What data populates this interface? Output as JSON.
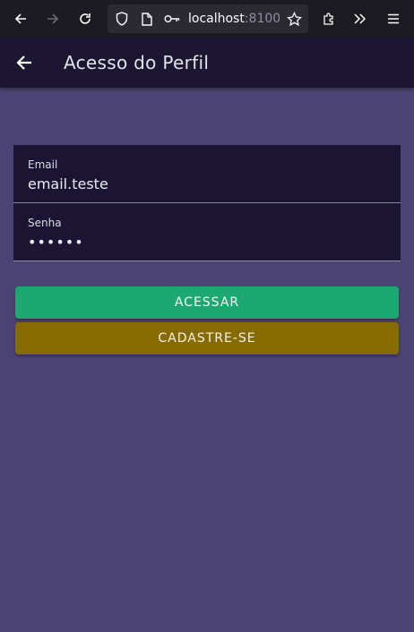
{
  "browser": {
    "url_host": "localhost",
    "url_rest": ":8100/"
  },
  "header": {
    "title": "Acesso do Perfil"
  },
  "form": {
    "email_label": "Email",
    "email_value": "email.teste",
    "senha_label": "Senha",
    "senha_value": "••••••"
  },
  "buttons": {
    "acessar": "ACESSAR",
    "cadastro": "CADASTRE-SE"
  },
  "colors": {
    "background": "#4b4373",
    "header": "#1d1633",
    "acessar": "#1ca870",
    "cadastro": "#866b00"
  }
}
